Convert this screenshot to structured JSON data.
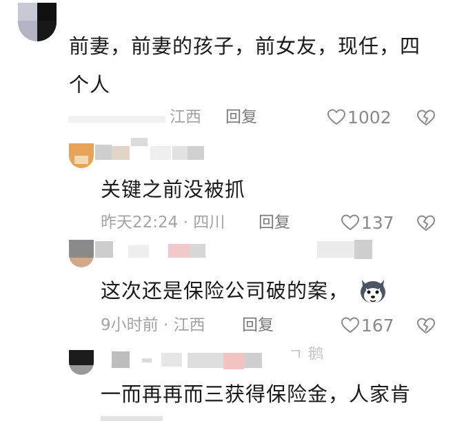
{
  "comments": [
    {
      "text_lines": [
        "前妻，前妻的孩子，前女友，现任，四",
        "个人"
      ],
      "meta": "江西",
      "reply": "回复",
      "likes": "1002"
    },
    {
      "text_lines": [
        "关键之前没被抓"
      ],
      "meta": "昨天22:24 · 四川",
      "reply": "回复",
      "likes": "137"
    },
    {
      "text_lines": [
        "这次还是保险公司破的案，"
      ],
      "meta": "9小时前 · 江西",
      "reply": "回复",
      "likes": "167",
      "emoji": "husky-emoji"
    },
    {
      "text_lines": [
        "一而再再而三获得保险金，人家肯"
      ],
      "username_partial": "ㄱ 鹅"
    }
  ],
  "icons": {
    "like": "heart-outline-icon",
    "dislike": "broken-heart-icon"
  },
  "colors": {
    "text": "#1a1a1a",
    "meta": "#a3a3a3",
    "reply": "#7a7a7a",
    "icon": "#8a8a8a"
  }
}
